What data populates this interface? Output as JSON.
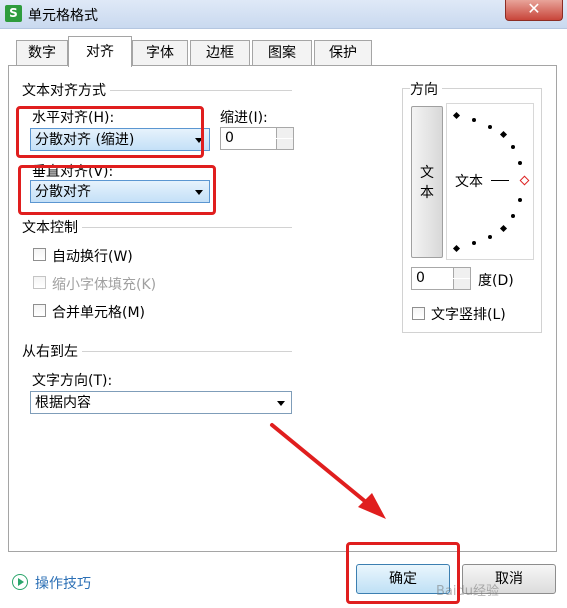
{
  "window": {
    "app_icon": "S",
    "title": "单元格格式",
    "close": "✕"
  },
  "tabs": [
    "数字",
    "对齐",
    "字体",
    "边框",
    "图案",
    "保护"
  ],
  "text_alignment": {
    "section": "文本对齐方式",
    "horizontal_label": "水平对齐(H):",
    "horizontal_value": "分散对齐 (缩进)",
    "indent_label": "缩进(I):",
    "indent_value": "0",
    "vertical_label": "垂直对齐(V):",
    "vertical_value": "分散对齐"
  },
  "text_control": {
    "section": "文本控制",
    "wrap": "自动换行(W)",
    "shrink": "缩小字体填充(K)",
    "merge": "合并单元格(M)"
  },
  "rtl": {
    "section": "从右到左",
    "direction_label": "文字方向(T):",
    "direction_value": "根据内容"
  },
  "orientation": {
    "section": "方向",
    "vertical_text": "文本",
    "dial_text": "文本",
    "degrees_value": "0",
    "degrees_label": "度(D)",
    "vertical_checkbox": "文字竖排(L)"
  },
  "footer": {
    "tips": "操作技巧",
    "ok": "确定",
    "cancel": "取消",
    "watermark": "Baidu经验"
  }
}
